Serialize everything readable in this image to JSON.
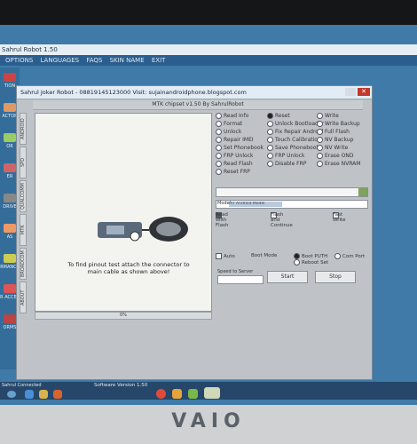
{
  "outer_app": {
    "title": "Sahrul Robot 1.50",
    "menu": [
      "OPTIONS",
      "LANGUAGES",
      "FAQS",
      "SKIN NAME",
      "EXIT"
    ]
  },
  "left_strip": [
    "TION",
    "ACTOR",
    "OR",
    "ER",
    "DRIVE",
    "AS",
    "RMANCE",
    "R ACCES",
    "ORMS"
  ],
  "window": {
    "title": "Sahrul Joker Robot - 08819145123000 Visit: sujainandroidphone.blogspot.com",
    "subtitle": "MTK chipset v1.50 By SahrulRobot",
    "vertical_tabs": [
      "ANDROID",
      "SPD",
      "QUALCOMM",
      "MTK",
      "BROADCOM",
      "ABOUT"
    ],
    "caption": "To find pinout test attach the connector to main cable as shown above!",
    "options": [
      [
        "Read Info",
        "Reset",
        "Write"
      ],
      [
        "Format",
        "Unlock Bootloader",
        "Write Backup"
      ],
      [
        "Unlock",
        "Fix Repair Android",
        "Full Flash"
      ],
      [
        "Repair IMEI",
        "Touch Calibration",
        "NV Backup"
      ],
      [
        "Set Phonebook",
        "Save Phonebook",
        "NV Write"
      ],
      [
        "FRP Unlock",
        "FRP Unlock",
        "Erase OND"
      ],
      [
        "Read Flash",
        "Disable FRP",
        "Erase NVRAM"
      ],
      [
        "Reset FRP",
        "",
        ""
      ]
    ],
    "selected_option": "Reset",
    "model_label": "Model",
    "model_value": "MT Android Model",
    "checks": {
      "read_with_flash": "Read With Flash",
      "flash_and_continue": "Flash and Continue",
      "fast_write": "Fast Write"
    },
    "bottom": {
      "auto_label": "Auto",
      "boot_label": "Boot Mode",
      "usb_label": "Boot PUTH",
      "reboot_label": "Reboot Set",
      "com_label": "Com Port",
      "start_label": "Start",
      "stop_label": "Stop",
      "speed_label": "Speed to Server"
    }
  },
  "taskbar": {
    "start_text": "Sahrul Connected",
    "task_text": "Software Version 1.50"
  },
  "brand": "VAIO"
}
